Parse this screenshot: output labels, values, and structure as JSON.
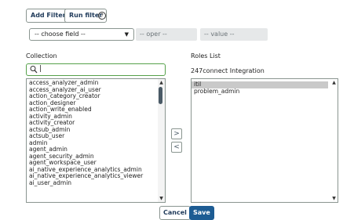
{
  "filter_bar": {
    "add_filter_label": "Add Filter",
    "run_filter_label": "Run filter",
    "help_glyph": "?"
  },
  "condition": {
    "field_value": "-- choose field --",
    "operator_value": "-- oper --",
    "value_value": "-- value --"
  },
  "collection": {
    "heading": "Collection",
    "search_value": "|",
    "items": [
      "access_analyzer_admin",
      "access_analyzer_ai_user",
      "action_category_creator",
      "action_designer",
      "action_write_enabled",
      "activity_admin",
      "activity_creator",
      "actsub_admin",
      "actsub_user",
      "admin",
      "agent_admin",
      "agent_security_admin",
      "agent_workspace_user",
      "ai_native_experience_analytics_admin",
      "ai_native_experience_analytics_viewer",
      "ai_user_admin"
    ]
  },
  "roles": {
    "heading": "Roles List",
    "subheading": "247connect Integration",
    "items": [
      "itil",
      "problem_admin"
    ],
    "selected_index": 0
  },
  "move_buttons": {
    "add_glyph": ">",
    "remove_glyph": "<"
  },
  "footer": {
    "cancel_label": "Cancel",
    "save_label": "Save"
  },
  "colors": {
    "save_background": "#1d5c93",
    "search_focus_border": "#55a14a",
    "selected_row": "#c9c9c9"
  },
  "icons": {
    "help": "help-icon",
    "search": "search-icon",
    "dropdown": "chevron-down-icon",
    "add": "chevron-right-icon",
    "remove": "chevron-left-icon"
  }
}
